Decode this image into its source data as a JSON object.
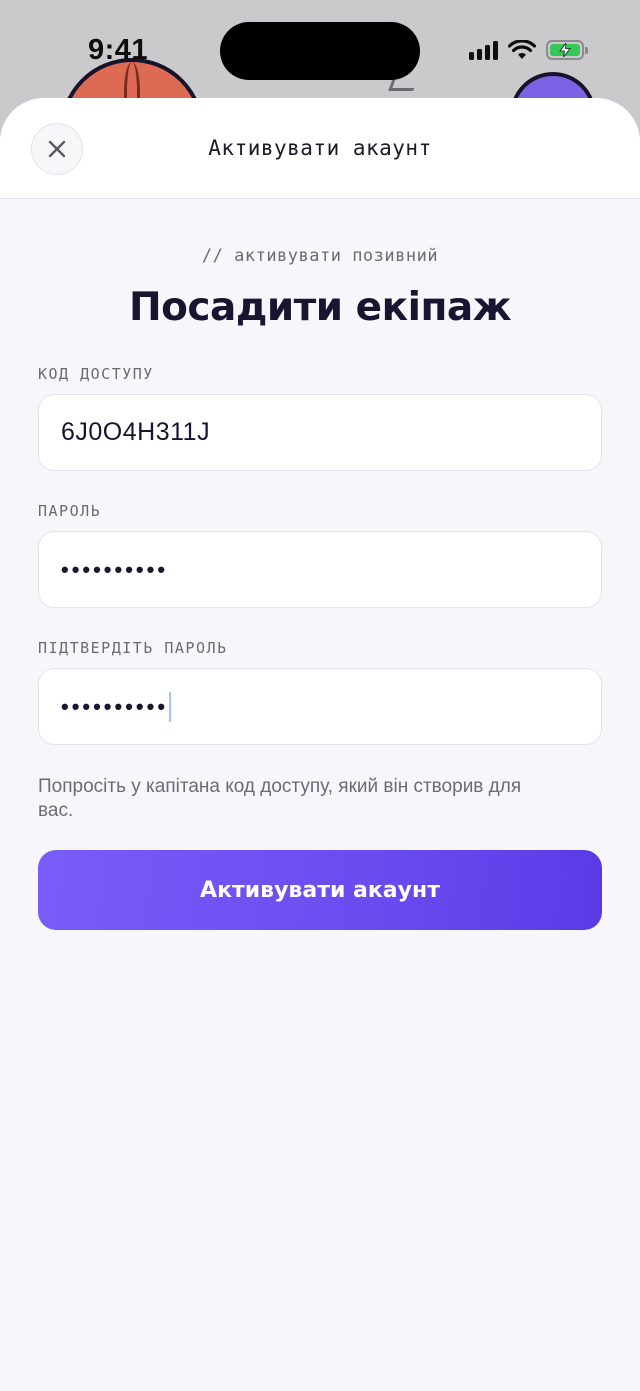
{
  "status_bar": {
    "time": "9:41"
  },
  "colors": {
    "accent": "#6a4bf0",
    "background": "#f7f7fb",
    "battery": "#34c759"
  },
  "header": {
    "title": "Активувати акаунт",
    "close_icon": "close-icon"
  },
  "main": {
    "eyebrow": "// активувати позивний",
    "headline": "Посадити екіпаж",
    "fields": {
      "access_code": {
        "label": "КОД ДОСТУПУ",
        "value": "6J0O4H311J"
      },
      "password": {
        "label": "ПАРОЛЬ",
        "value": "••••••••••"
      },
      "confirm_password": {
        "label": "ПІДТВЕРДІТЬ ПАРОЛЬ",
        "value": "••••••••••"
      }
    },
    "hint": "Попросіть у капітана код доступу, який він створив для вас.",
    "submit_label": "Активувати акаунт"
  }
}
